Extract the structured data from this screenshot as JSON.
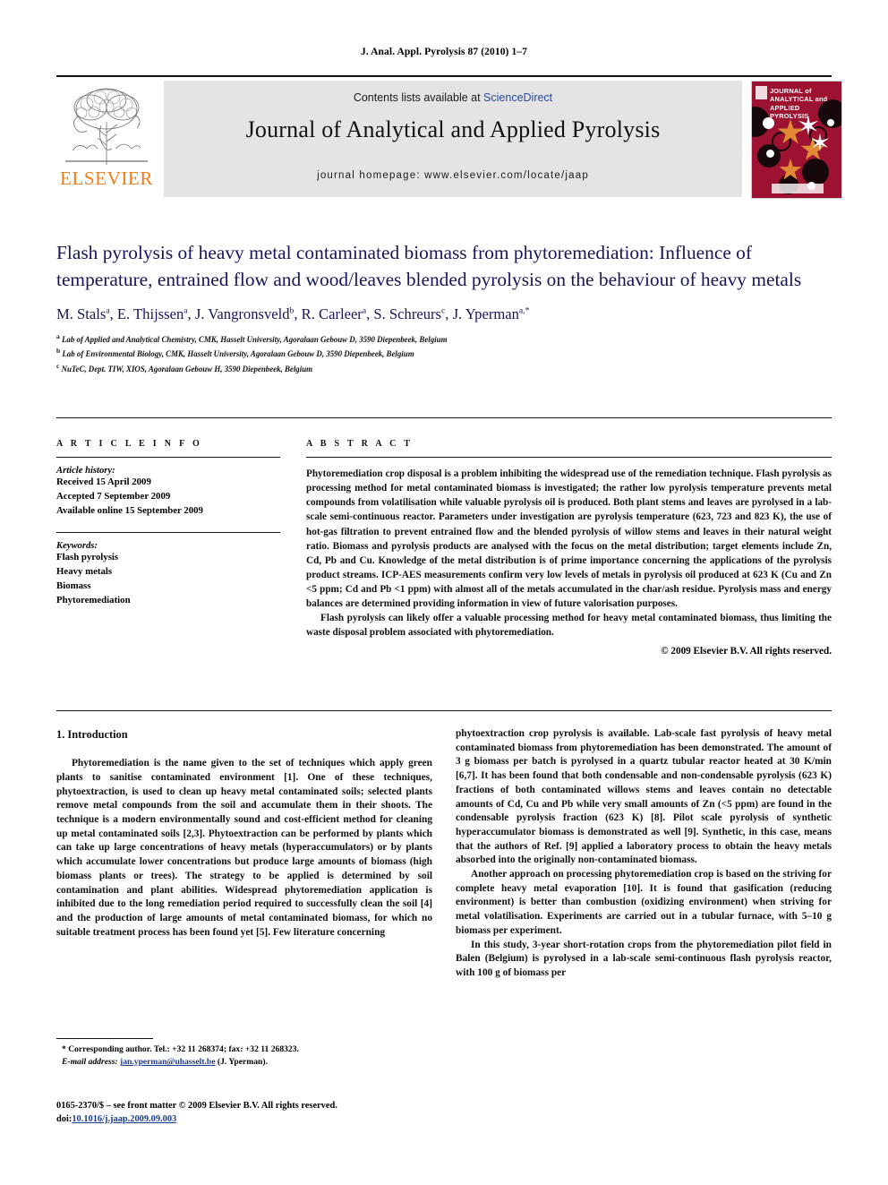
{
  "running_head": "J. Anal. Appl. Pyrolysis 87 (2010) 1–7",
  "masthead": {
    "contents_prefix": "Contents lists available at ",
    "contents_link": "ScienceDirect",
    "journal_title": "Journal of Analytical and Applied Pyrolysis",
    "homepage": "journal homepage: www.elsevier.com/locate/jaap",
    "publisher_wordmark": "ELSEVIER",
    "cover_title": "JOURNAL of ANALYTICAL and APPLIED PYROLYSIS",
    "accent_orange": "#ef7c1a",
    "banner_gray": "#e4e4e4",
    "cover_red": "#9c1230",
    "link_blue": "#2a4b9b"
  },
  "article": {
    "title": "Flash pyrolysis of heavy metal contaminated biomass from phytoremediation: Influence of temperature, entrained flow and wood/leaves blended pyrolysis on the behaviour of heavy metals",
    "authors": "M. Stals a, E. Thijssen a, J. Vangronsveld b, R. Carleer a, S. Schreurs c, J. Yperman a,*",
    "author_list": [
      {
        "name": "M. Stals",
        "marks": "a"
      },
      {
        "name": "E. Thijssen",
        "marks": "a"
      },
      {
        "name": "J. Vangronsveld",
        "marks": "b"
      },
      {
        "name": "R. Carleer",
        "marks": "a"
      },
      {
        "name": "S. Schreurs",
        "marks": "c"
      },
      {
        "name": "J. Yperman",
        "marks": "a,*"
      }
    ],
    "affiliations": [
      {
        "mark": "a",
        "text": "Lab of Applied and Analytical Chemistry, CMK, Hasselt University, Agoralaan Gebouw D, 3590 Diepenbeek, Belgium"
      },
      {
        "mark": "b",
        "text": "Lab of Environmental Biology, CMK, Hasselt University, Agoralaan Gebouw D, 3590 Diepenbeek, Belgium"
      },
      {
        "mark": "c",
        "text": "NuTeC, Dept. TIW, XIOS, Agoralaan Gebouw H, 3590 Diepenbeek, Belgium"
      }
    ],
    "title_color": "#15165a"
  },
  "article_info": {
    "heading": "A R T I C L E   I N F O",
    "history_label": "Article history:",
    "history": [
      "Received 15 April 2009",
      "Accepted 7 September 2009",
      "Available online 15 September 2009"
    ],
    "keywords_label": "Keywords:",
    "keywords": [
      "Flash pyrolysis",
      "Heavy metals",
      "Biomass",
      "Phytoremediation"
    ]
  },
  "abstract": {
    "heading": "A B S T R A C T",
    "paragraphs": [
      "Phytoremediation crop disposal is a problem inhibiting the widespread use of the remediation technique. Flash pyrolysis as processing method for metal contaminated biomass is investigated; the rather low pyrolysis temperature prevents metal compounds from volatilisation while valuable pyrolysis oil is produced. Both plant stems and leaves are pyrolysed in a lab-scale semi-continuous reactor. Parameters under investigation are pyrolysis temperature (623, 723 and 823 K), the use of hot-gas filtration to prevent entrained flow and the blended pyrolysis of willow stems and leaves in their natural weight ratio. Biomass and pyrolysis products are analysed with the focus on the metal distribution; target elements include Zn, Cd, Pb and Cu. Knowledge of the metal distribution is of prime importance concerning the applications of the pyrolysis product streams. ICP-AES measurements confirm very low levels of metals in pyrolysis oil produced at 623 K (Cu and Zn <5 ppm; Cd and Pb <1 ppm) with almost all of the metals accumulated in the char/ash residue. Pyrolysis mass and energy balances are determined providing information in view of future valorisation purposes.",
      "Flash pyrolysis can likely offer a valuable processing method for heavy metal contaminated biomass, thus limiting the waste disposal problem associated with phytoremediation."
    ],
    "copyright": "© 2009 Elsevier B.V. All rights reserved."
  },
  "body": {
    "section_heading": "1. Introduction",
    "left_paragraphs": [
      "Phytoremediation is the name given to the set of techniques which apply green plants to sanitise contaminated environment [1]. One of these techniques, phytoextraction, is used to clean up heavy metal contaminated soils; selected plants remove metal compounds from the soil and accumulate them in their shoots. The technique is a modern environmentally sound and cost-efficient method for cleaning up metal contaminated soils [2,3]. Phytoextraction can be performed by plants which can take up large concentrations of heavy metals (hyperaccumulators) or by plants which accumulate lower concentrations but produce large amounts of biomass (high biomass plants or trees). The strategy to be applied is determined by soil contamination and plant abilities. Widespread phytoremediation application is inhibited due to the long remediation period required to successfully clean the soil [4] and the production of large amounts of metal contaminated biomass, for which no suitable treatment process has been found yet [5]. Few literature concerning"
    ],
    "right_paragraphs": [
      "phytoextraction crop pyrolysis is available. Lab-scale fast pyrolysis of heavy metal contaminated biomass from phytoremediation has been demonstrated. The amount of 3 g biomass per batch is pyrolysed in a quartz tubular reactor heated at 30 K/min [6,7]. It has been found that both condensable and non-condensable pyrolysis (623 K) fractions of both contaminated willows stems and leaves contain no detectable amounts of Cd, Cu and Pb while very small amounts of Zn (<5 ppm) are found in the condensable pyrolysis fraction (623 K) [8]. Pilot scale pyrolysis of synthetic hyperaccumulator biomass is demonstrated as well [9]. Synthetic, in this case, means that the authors of Ref. [9] applied a laboratory process to obtain the heavy metals absorbed into the originally non-contaminated biomass.",
      "Another approach on processing phytoremediation crop is based on the striving for complete heavy metal evaporation [10]. It is found that gasification (reducing environment) is better than combustion (oxidizing environment) when striving for metal volatilisation. Experiments are carried out in a tubular furnace, with 5–10 g biomass per experiment.",
      "In this study, 3-year short-rotation crops from the phytoremediation pilot field in Balen (Belgium) is pyrolysed in a lab-scale semi-continuous flash pyrolysis reactor, with 100 g of biomass per"
    ]
  },
  "footnotes": {
    "corresponding": "* Corresponding author. Tel.: +32 11 268374; fax: +32 11 268323.",
    "email_label": "E-mail address:",
    "email": "jan.yperman@uhasselt.be",
    "email_suffix": "(J. Yperman)."
  },
  "imprint": {
    "line1": "0165-2370/$ – see front matter © 2009 Elsevier B.V. All rights reserved.",
    "doi_label": "doi:",
    "doi": "10.1016/j.jaap.2009.09.003"
  }
}
